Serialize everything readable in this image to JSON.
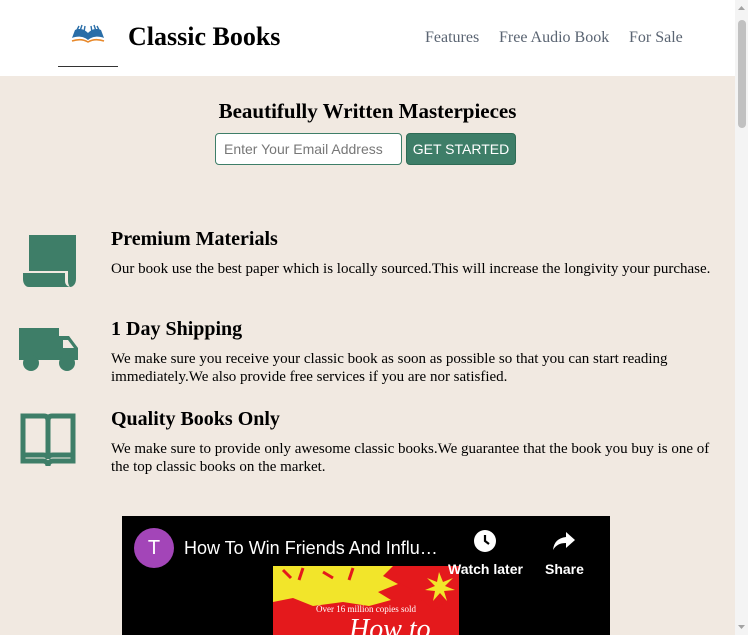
{
  "header": {
    "brand": "Classic Books",
    "nav": [
      "Features",
      "Free Audio Book",
      "For Sale"
    ]
  },
  "hero": {
    "title": "Beautifully Written Masterpieces",
    "email_placeholder": "Enter Your Email Address",
    "button_label": "GET STARTED"
  },
  "features": [
    {
      "icon": "document-icon",
      "title": "Premium Materials",
      "desc": "Our book use the best paper which is locally sourced.This will increase the longivity your purchase."
    },
    {
      "icon": "truck-icon",
      "title": "1 Day Shipping",
      "desc": "We make sure you receive your classic book as soon as possible so that you can start reading immediately.We also provide free services if you are nor satisfied."
    },
    {
      "icon": "open-book-icon",
      "title": "Quality Books Only",
      "desc": "We make sure to provide only awesome classic books.We guarantee that the book you buy is one of the top classic books on the market."
    }
  ],
  "video": {
    "channel_initial": "T",
    "title": "How To Win Friends And Influence People",
    "watch_later": "Watch later",
    "share": "Share",
    "cover_top_text": "Over 16 million copies sold",
    "cover_big_text": "How to"
  },
  "colors": {
    "accent": "#3e7e68",
    "background": "#f1e9e1",
    "nav_text": "#5a6472",
    "avatar": "#a345b8"
  }
}
